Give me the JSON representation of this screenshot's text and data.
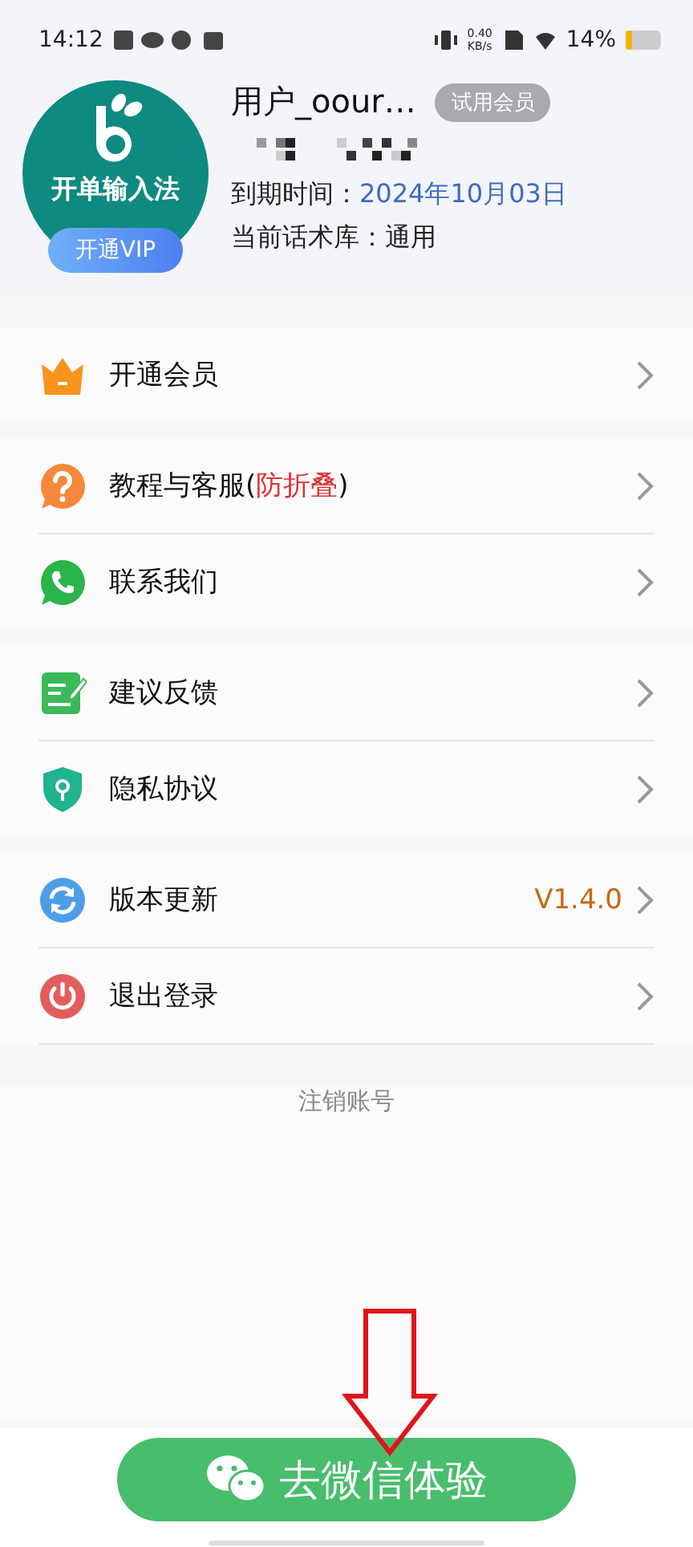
{
  "status_bar": {
    "time": "14:12",
    "speed_value": "0.40",
    "speed_unit": "KB/s",
    "battery": "14%"
  },
  "profile": {
    "logo_text": "开单输入法",
    "vip_button": "开通VIP",
    "username": "用户_oour…",
    "badge": "试用会员",
    "expiry_label": "到期时间：",
    "expiry_value": "2024年10月03日",
    "library_label": "当前话术库：",
    "library_value": "通用"
  },
  "groups": [
    {
      "items": [
        {
          "kind": "crown",
          "label_parts": [
            {
              "text": "开通会员",
              "highlight": false
            }
          ]
        }
      ]
    },
    {
      "items": [
        {
          "kind": "question",
          "label_parts": [
            {
              "text": "教程与客服(",
              "highlight": false
            },
            {
              "text": "防折叠",
              "highlight": true
            },
            {
              "text": ")",
              "highlight": false
            }
          ]
        },
        {
          "kind": "phone",
          "label_parts": [
            {
              "text": "联系我们",
              "highlight": false
            }
          ]
        }
      ]
    },
    {
      "items": [
        {
          "kind": "feedback",
          "label_parts": [
            {
              "text": "建议反馈",
              "highlight": false
            }
          ]
        },
        {
          "kind": "shield",
          "label_parts": [
            {
              "text": "隐私协议",
              "highlight": false
            }
          ]
        }
      ]
    },
    {
      "items": [
        {
          "kind": "refresh",
          "label_parts": [
            {
              "text": "版本更新",
              "highlight": false
            }
          ],
          "value": "V1.4.0"
        },
        {
          "kind": "power",
          "label_parts": [
            {
              "text": "退出登录",
              "highlight": false
            }
          ]
        }
      ]
    }
  ],
  "delete_account": "注销账号",
  "wechat_button": "去微信体验"
}
